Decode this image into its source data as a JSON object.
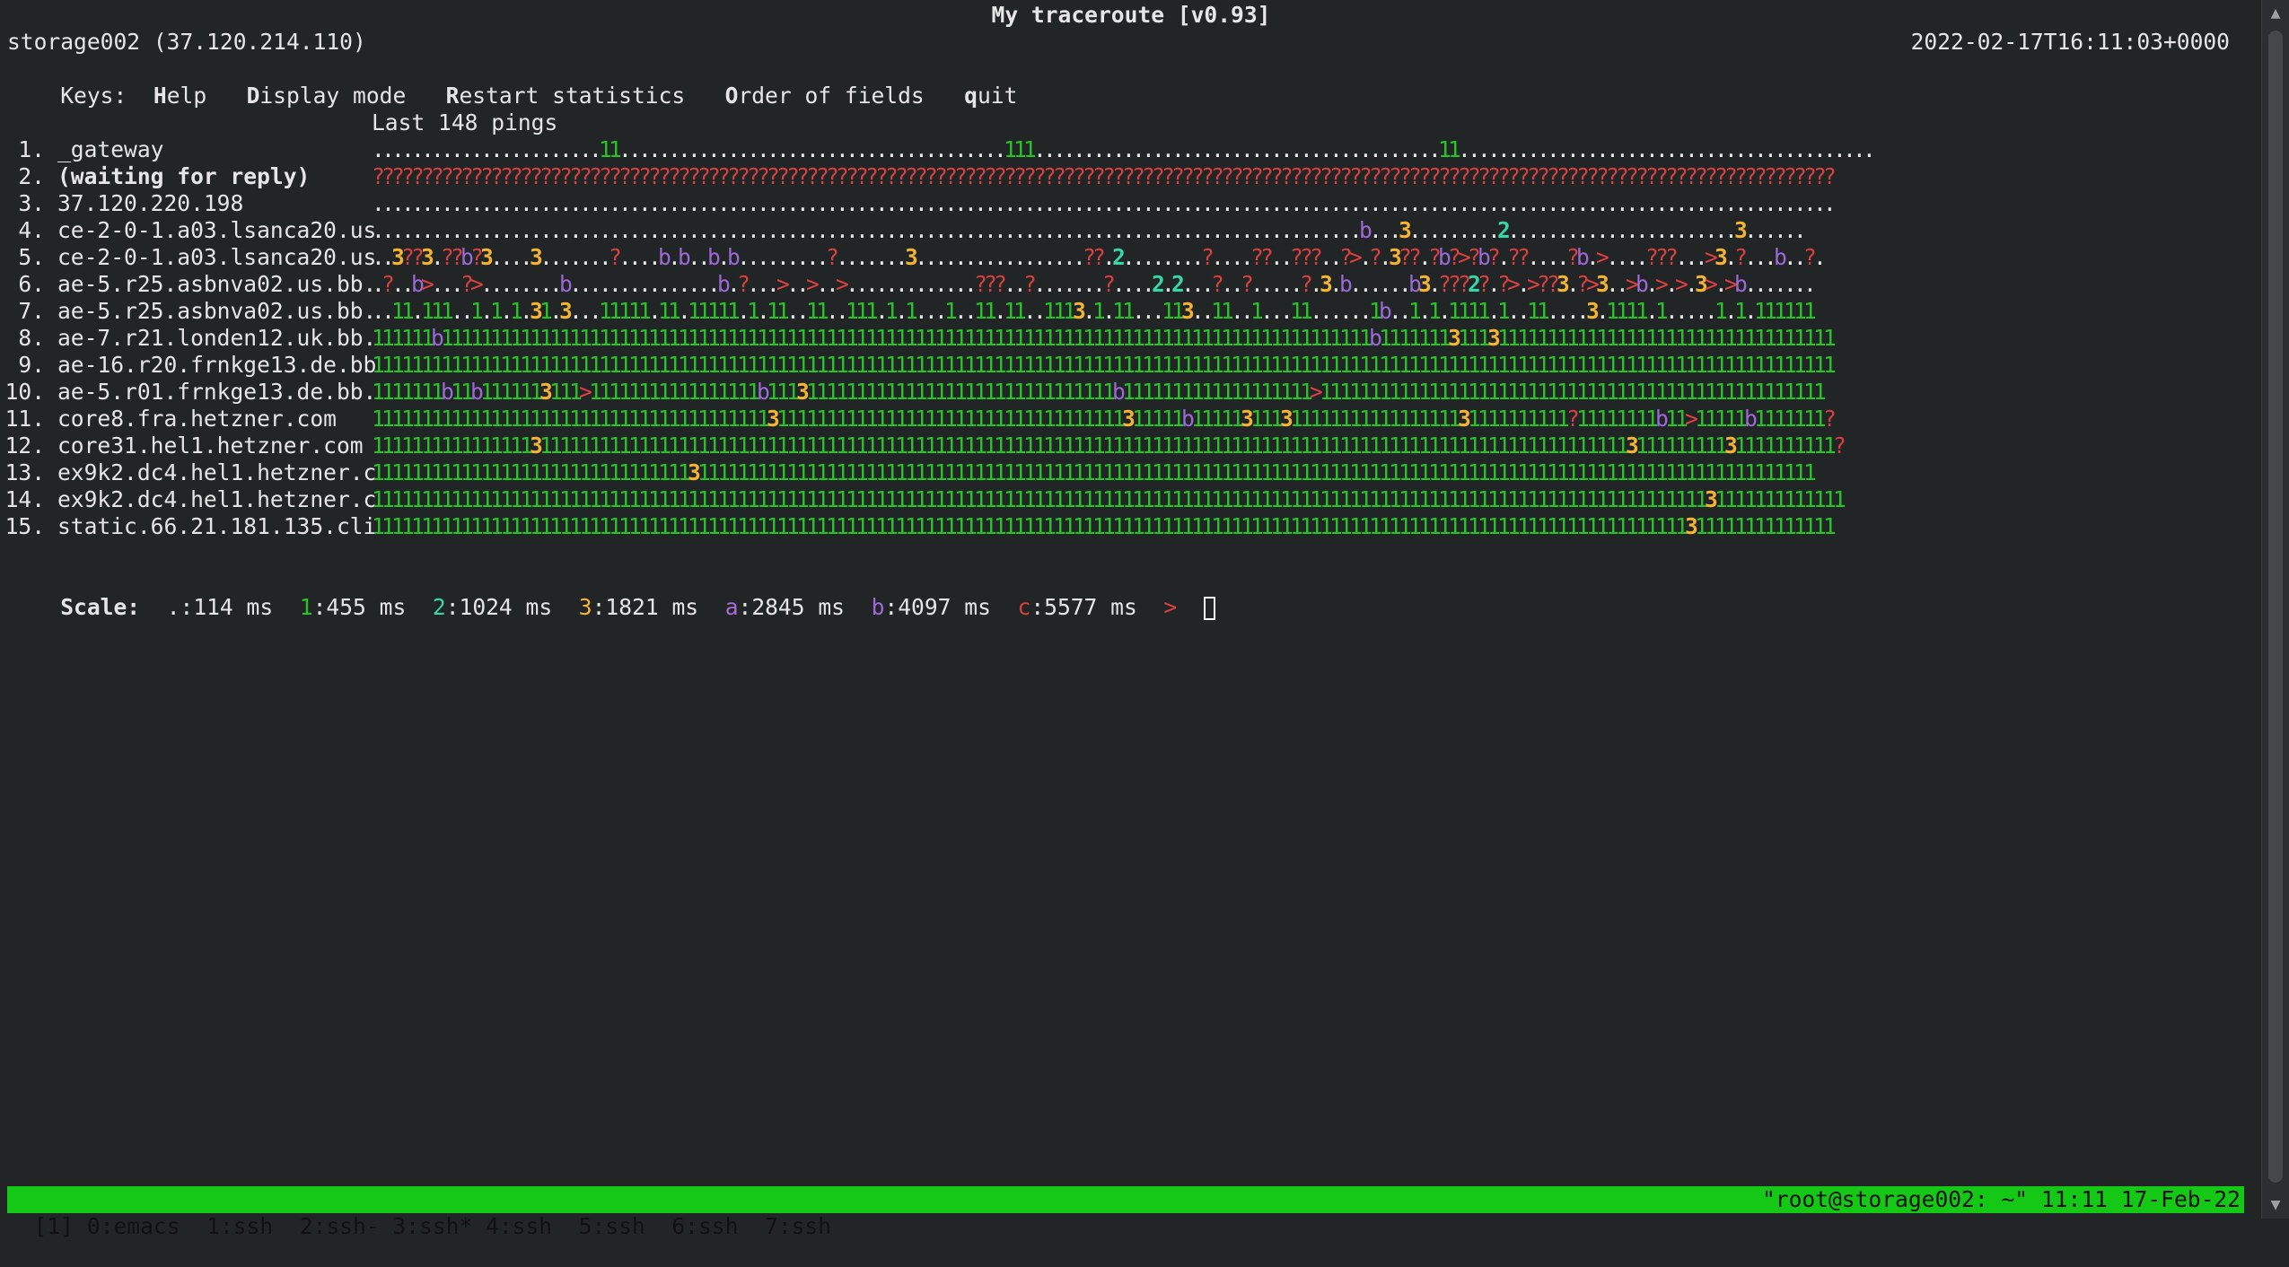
{
  "header": {
    "title": "My traceroute  [v0.93]",
    "host": "storage002 (37.120.214.110)",
    "datetime": "2022-02-17T16:11:03+0000"
  },
  "keys": {
    "prefix": "Keys:",
    "items": [
      {
        "key": "H",
        "rest": "elp"
      },
      {
        "key": "D",
        "rest": "isplay mode"
      },
      {
        "key": "R",
        "rest": "estart statistics"
      },
      {
        "key": "O",
        "rest": "rder of fields"
      },
      {
        "key": "q",
        "rest": "uit"
      }
    ]
  },
  "pings_header": "Last 148 pings",
  "hops": [
    {
      "num": "1.",
      "name": "_gateway",
      "pings": ".......................11.......................................111.........................................11.........................................."
    },
    {
      "num": "2.",
      "name": "(waiting for reply)",
      "pings": "????????????????????????????????????????????????????????????????????????????????????????????????????????????????????????????????????????????????????"
    },
    {
      "num": "3.",
      "name": "37.120.220.198",
      "pings": "...................................................................................................................................................."
    },
    {
      "num": "4.",
      "name": "ce-2-0-1.a03.lsanca20.us",
      "pings": "....................................................................................................b...3.........2.......................3......"
    },
    {
      "num": "5.",
      "name": "ce-2-0-1.a03.lsanca20.us",
      "pings": "..3??3.??b?3....3.......?....b.b..b.b.........?.......3.................??.2........?....??..???..?>.?.3??.?b?>?b?.??....?b.>....???...>3.?...b..?."
    },
    {
      "num": "6.",
      "name": "ae-5.r25.asbnva02.us.bb.",
      "pings": ".?..b>...?>........b...............b.?...>..>..>.............???..?.......?....2.2...?..?.....?.3.b......b3.???2?.?>.>??3.?>3..>b.>.>.3>.>b......."
    },
    {
      "num": "7.",
      "name": "ae-5.r25.asbnva02.us.bb.",
      "pings": "..11.111..1.1.1.31.3...11111.11.11111.1.11..11..111.1.1...1..11.11..1113.1.11...113..11..1...11......1b..1.1.1111.1..11....3.1111.1.....1.1.111111"
    },
    {
      "num": "8.",
      "name": "ae-7.r21.londen12.uk.bb.",
      "pings": "111111b1111111111111111111111111111111111111111111111111111111111111111111111111111111111111111111111b1111111311131111111111111111111111111111111111"
    },
    {
      "num": "9.",
      "name": "ae-16.r20.frnkge13.de.bb",
      "pings": "1111111111111111111111111111111111111111111111111111111111111111111111111111111111111111111111111111111111111111111111111111111111111111111111111111"
    },
    {
      "num": "10.",
      "name": "ae-5.r01.frnkge13.de.bb.",
      "pings": "1111111b11b1111113111>11111111111111111b11131111111111111111111111111111111b1111111111111111111>111111111111111111111111111111111111111111111111111"
    },
    {
      "num": "11.",
      "name": "core8.fra.hetzner.com",
      "pings": "1111111111111111111111111111111111111111311111111111111111111111111111111111311111b11111311131111111111111111131111111111?11111111b11>11111b1111111?"
    },
    {
      "num": "12.",
      "name": "core31.hel1.hetzner.com",
      "pings": "1111111111111111311111111111111111111111111111111111111111111111111111111111111111111111111111111111111111111111111111111111111311111111131111111111?"
    },
    {
      "num": "13.",
      "name": "ex9k2.dc4.hel1.hetzner.c",
      "pings": "11111111111111111111111111111111311111111111111111111111111111111111111111111111111111111111111111111111111111111111111111111111111111111111111111"
    },
    {
      "num": "14.",
      "name": "ex9k2.dc4.hel1.hetzner.c",
      "pings": "11111111111111111111111111111111111111111111111111111111111111111111111111111111111111111111111111111111111111111111111111111111111111131111111111111"
    },
    {
      "num": "15.",
      "name": "static.66.21.181.135.cli",
      "pings": "1111111111111111111111111111111111111111111111111111111111111111111111111111111111111111111111111111111111111111111111111111111111111311111111111111"
    }
  ],
  "scale": {
    "label": "Scale:",
    "items": [
      {
        "sym": ".",
        "val": ":114 ms",
        "color": "#e6e6e6"
      },
      {
        "sym": "1",
        "val": ":455 ms",
        "color": "#29c229"
      },
      {
        "sym": "2",
        "val": ":1024 ms",
        "color": "#36d6a6"
      },
      {
        "sym": "3",
        "val": ":1821 ms",
        "color": "#f4b431"
      },
      {
        "sym": "a",
        "val": ":2845 ms",
        "color": "#a96cd8"
      },
      {
        "sym": "b",
        "val": ":4097 ms",
        "color": "#9c6ad8"
      },
      {
        "sym": "c",
        "val": ":5577 ms",
        "color": "#d84040"
      },
      {
        "sym": ">",
        "val": "",
        "color": "#e04040"
      }
    ]
  },
  "statusbar": {
    "left": "[1] 0:emacs  1:ssh  2:ssh- 3:ssh* 4:ssh  5:ssh  6:ssh  7:ssh",
    "right": "\"root@storage002: ~\" 11:11 17-Feb-22"
  },
  "colors": {
    "background": "#222526",
    "status_bar": "#16c816"
  }
}
